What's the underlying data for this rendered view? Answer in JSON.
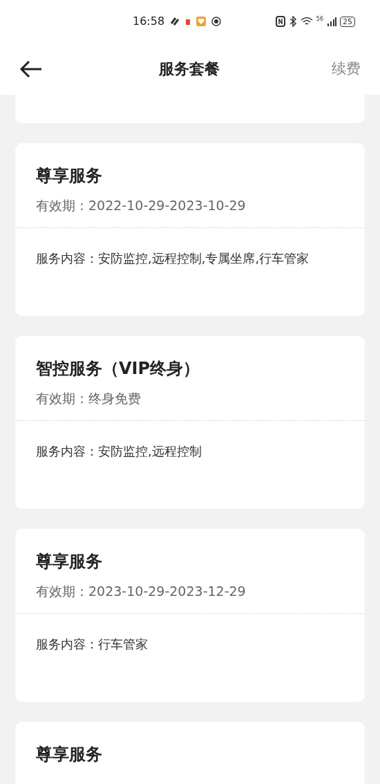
{
  "status_bar": {
    "time": "16:58",
    "network": "56",
    "battery": "25"
  },
  "header": {
    "title": "服务套餐",
    "action": "续费"
  },
  "cards": [
    {
      "title": "尊享服务",
      "validity": "有效期：2022-10-29-2023-10-29",
      "content": "服务内容：安防监控,远程控制,专属坐席,行车管家"
    },
    {
      "title": "智控服务（VIP终身）",
      "validity": "有效期：终身免费",
      "content": "服务内容：安防监控,远程控制"
    },
    {
      "title": "尊享服务",
      "validity": "有效期：2023-10-29-2023-12-29",
      "content": "服务内容：行车管家"
    },
    {
      "title": "尊享服务"
    }
  ]
}
